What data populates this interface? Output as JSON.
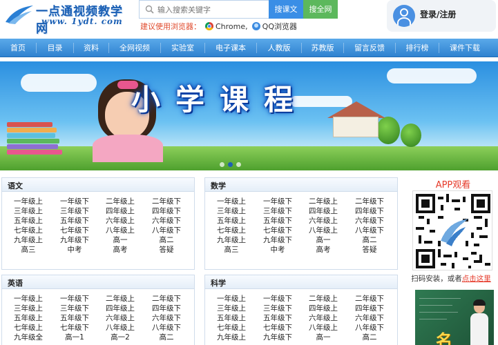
{
  "site": {
    "logo_title": "一点通视频教学网",
    "logo_url": "www. 1ydt. com"
  },
  "search": {
    "placeholder": "输入搜索关键字",
    "btn_text": "搜课文",
    "btn_full": "搜全网"
  },
  "browser_tip": {
    "label": "建议使用浏览器：",
    "chrome": "Chrome,",
    "qq": "QQ浏览器"
  },
  "login": {
    "label": "登录/注册"
  },
  "nav": {
    "items": [
      "首页",
      "目录",
      "资料",
      "全网视频",
      "实验室",
      "电子课本",
      "人教版",
      "苏教版",
      "留言反馈",
      "排行榜",
      "课件下载"
    ]
  },
  "banner": {
    "heading": "小学课程"
  },
  "grade_links": {
    "main": [
      "一年级上",
      "一年级下",
      "二年级上",
      "二年级下",
      "三年级上",
      "三年级下",
      "四年级上",
      "四年级下",
      "五年级上",
      "五年级下",
      "六年级上",
      "六年级下",
      "七年级上",
      "七年级下",
      "八年级上",
      "八年级下",
      "九年级上",
      "九年级下",
      "高一",
      "高二",
      "高三",
      "中考",
      "高考",
      "答疑"
    ],
    "english": [
      "一年级上",
      "一年级下",
      "二年级上",
      "二年级下",
      "三年级上",
      "三年级下",
      "四年级上",
      "四年级下",
      "五年级上",
      "五年级下",
      "六年级上",
      "六年级下",
      "七年级上",
      "七年级下",
      "八年级上",
      "八年级下",
      "九年级全",
      "高一1",
      "高一2",
      "高二"
    ]
  },
  "panels": {
    "chinese": "语文",
    "math": "数学",
    "english": "英语",
    "science": "科学"
  },
  "app": {
    "title": "APP观看",
    "scan_text": "扫码安装，或者",
    "scan_link": "点击这里",
    "video_char": "名"
  },
  "colors": {
    "nav_blue": "#2f82d0",
    "accent_red": "#e63a2a",
    "search_blue": "#3a8ee6",
    "search_green": "#5cb85c"
  }
}
